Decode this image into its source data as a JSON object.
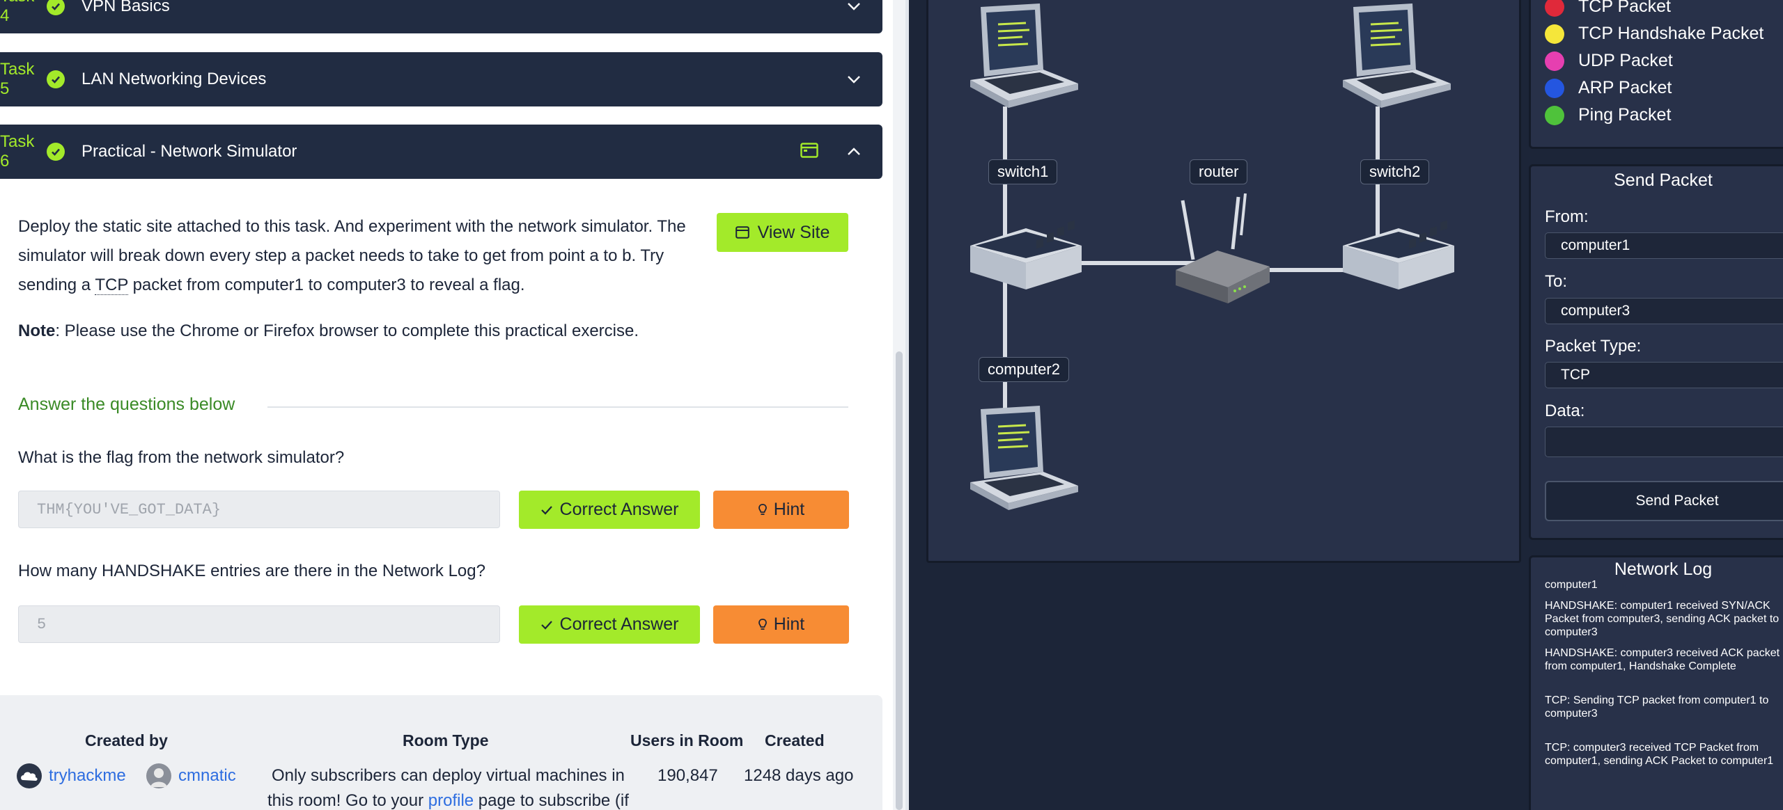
{
  "tasks": [
    {
      "num": "Task 4",
      "title": "VPN Basics"
    },
    {
      "num": "Task 5",
      "title": "LAN Networking Devices"
    },
    {
      "num": "Task 6",
      "title": "Practical - Network Simulator"
    }
  ],
  "task6": {
    "description_1": "Deploy the static site attached to this task. And experiment with the network simulator. The",
    "description_2": "simulator will break down every step a packet needs to take to get from point a to b. Try",
    "description_3a": "sending a ",
    "description_3_abbr": "TCP",
    "description_3b": " packet from computer1 to computer3 to reveal a flag.",
    "note_label": "Note",
    "note_text": ": Please use the Chrome or Firefox browser to complete this practical exercise.",
    "view_site": "View Site",
    "answer_heading": "Answer the questions below",
    "questions": [
      {
        "q": "What is the flag from the network simulator?",
        "answer": "THM{YOU'VE_GOT_DATA}",
        "correct": "Correct Answer",
        "hint": "Hint"
      },
      {
        "q": "How many HANDSHAKE entries are there in the Network Log?",
        "answer": "5",
        "correct": "Correct Answer",
        "hint": "Hint"
      }
    ]
  },
  "footer": {
    "created_by_h": "Created by",
    "room_type_h": "Room Type",
    "users_h": "Users in Room",
    "created_h": "Created",
    "creator1": "tryhackme",
    "creator2": "cmnatic",
    "room_type_1": "Only subscribers can deploy virtual machines in",
    "room_type_2a": "this room! Go to your ",
    "room_type_link": "profile",
    "room_type_2b": " page to subscribe (if",
    "users": "190,847",
    "created": "1248 days ago"
  },
  "simulator": {
    "nodes": {
      "switch1": "switch1",
      "router": "router",
      "switch2": "switch2",
      "computer2": "computer2"
    },
    "legend": [
      {
        "label": "TCP Packet",
        "color": "#e0293a"
      },
      {
        "label": "TCP Handshake Packet",
        "color": "#f5e63a"
      },
      {
        "label": "UDP Packet",
        "color": "#e63fb0"
      },
      {
        "label": "ARP Packet",
        "color": "#2456e0"
      },
      {
        "label": "Ping Packet",
        "color": "#4fc23b"
      }
    ],
    "send_packet": {
      "title": "Send Packet",
      "from_label": "From:",
      "from_value": "computer1",
      "to_label": "To:",
      "to_value": "computer3",
      "type_label": "Packet Type:",
      "type_value": "TCP",
      "data_label": "Data:",
      "data_value": "",
      "button": "Send Packet"
    },
    "log": {
      "title": "Network Log",
      "entries": [
        "computer1",
        "HANDSHAKE: computer1 received SYN/ACK Packet from computer3, sending ACK packet to computer3",
        "HANDSHAKE: computer3 received ACK packet from computer1, Handshake Complete",
        "TCP: Sending TCP packet from computer1 to computer3",
        "TCP: computer3 received TCP Packet from computer1, sending ACK Packet to computer1"
      ]
    }
  }
}
